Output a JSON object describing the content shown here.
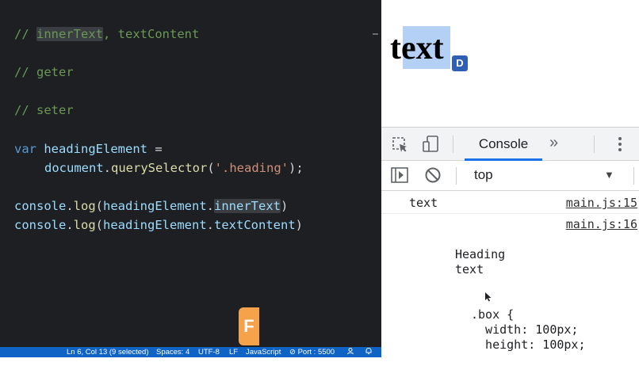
{
  "editor": {
    "lines": {
      "l1_comment_prefix": "// ",
      "l1_highlight": "innerText",
      "l1_rest": ", textContent",
      "l2": "// geter",
      "l3": "// seter",
      "l4_kw": "var",
      "l4_var": "headingElement",
      "l4_op": " =",
      "l5_obj": "document",
      "l5_dot": ".",
      "l5_fn": "querySelector",
      "l5_open": "(",
      "l5_str": "'.heading'",
      "l5_close": ");",
      "l6_obj": "console",
      "l6_dot": ".",
      "l6_fn": "log",
      "l6_open": "(",
      "l6_var": "headingElement",
      "l6_dot2": ".",
      "l6_prop": "innerText",
      "l6_close": ")",
      "l7_obj": "console",
      "l7_dot": ".",
      "l7_fn": "log",
      "l7_open": "(",
      "l7_var": "headingElement",
      "l7_dot2": ".",
      "l7_prop": "textContent",
      "l7_close": ")"
    }
  },
  "statusbar": {
    "position": "Ln 6, Col 13 (9 selected)",
    "spaces": "Spaces: 4",
    "encoding": "UTF-8",
    "eol": "LF",
    "language": "JavaScript",
    "port": "⊘ Port : 5500"
  },
  "page": {
    "heading": "text",
    "badge": "D"
  },
  "devtools": {
    "tab_console": "Console",
    "more_tabs": "»",
    "context": "top",
    "logs": [
      {
        "text": "text",
        "source": "main.js:15"
      },
      {
        "text": "",
        "source": "main.js:16"
      }
    ],
    "output_lines": {
      "a": "Heading",
      "b": "text",
      "c": ".box {",
      "d": "  width: 100px;",
      "e": "  height: 100px;"
    }
  },
  "overlay": {
    "badge": "F"
  },
  "colors": {
    "editor_bg": "#1e1f22",
    "statusbar_bg": "#0e63c4",
    "accent": "#1a73e8",
    "selection": "#b4d0f5"
  }
}
